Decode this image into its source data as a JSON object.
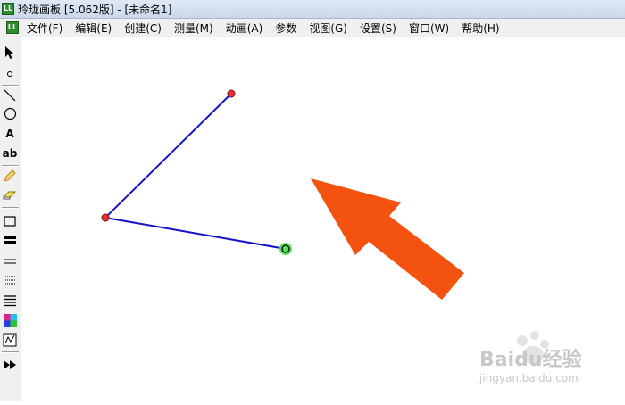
{
  "window": {
    "title": "玲珑画板 [5.062版] - [未命名1]",
    "app_icon": "app-logo-icon"
  },
  "menubar": {
    "items": [
      {
        "label": "文件(F)"
      },
      {
        "label": "编辑(E)"
      },
      {
        "label": "创建(C)"
      },
      {
        "label": "测量(M)"
      },
      {
        "label": "动画(A)"
      },
      {
        "label": "参数"
      },
      {
        "label": "视图(G)"
      },
      {
        "label": "设置(S)"
      },
      {
        "label": "窗口(W)"
      },
      {
        "label": "帮助(H)"
      }
    ]
  },
  "toolbox": {
    "text_tool_label": "A",
    "label_tool_label": "ab",
    "tools": [
      "arrow-icon",
      "point-icon",
      "segment-icon",
      "circle-icon",
      "text-icon",
      "label-icon",
      "pencil-icon",
      "eraser-icon",
      "rectangle-icon",
      "thick-line-icon",
      "thin-line-icon",
      "dotted-line-icon",
      "multi-line-icon",
      "color-palette-icon",
      "graph-icon",
      "play-forward-icon"
    ]
  },
  "canvas": {
    "segment_color": "#1515c8",
    "point_color": "#e83030",
    "selected_point_color": "#57e157",
    "arrow_color": "#f4520f"
  },
  "watermark": {
    "brand": "Baidu经验",
    "url": "jingyan.baidu.com"
  }
}
